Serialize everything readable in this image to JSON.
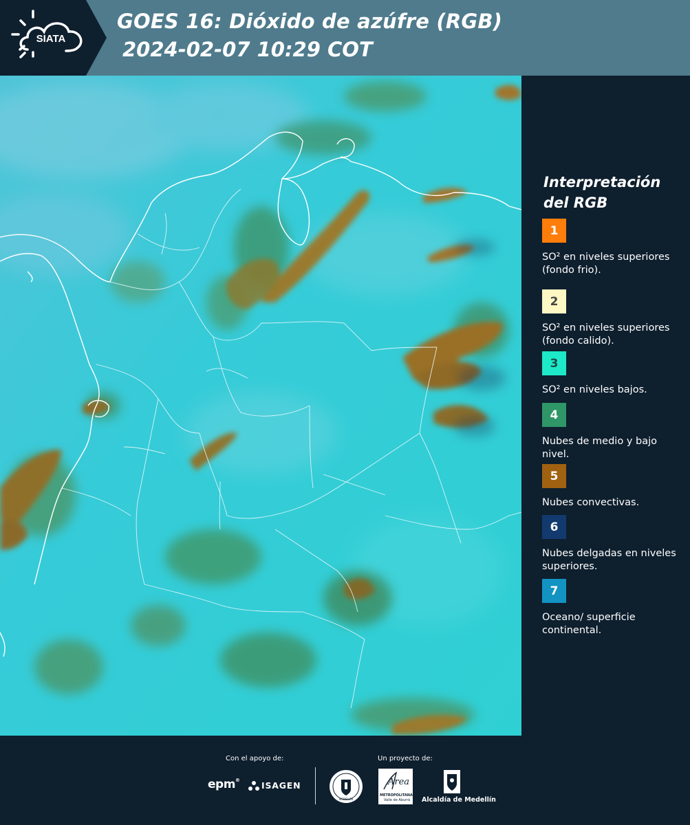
{
  "header": {
    "logo_text": "SIATA",
    "title_line1": "GOES 16: Dióxido de azúfre (RGB)",
    "title_line2": "2024-02-07 10:29 COT"
  },
  "legend": {
    "title_line1": "Interpretación",
    "title_line2": "del RGB",
    "items": [
      {
        "number": "1",
        "label": "SO² en niveles superiores (fondo frio).",
        "color": "#ff7d0a",
        "text_color": "#ffffff"
      },
      {
        "number": "2",
        "label": "SO² en niveles superiores (fondo calido).",
        "color": "#fff7c4",
        "text_color": "#444444"
      },
      {
        "number": "3",
        "label": "SO² en niveles bajos.",
        "color": "#1de8c8",
        "text_color": "#1c4a44"
      },
      {
        "number": "4",
        "label": "Nubes de medio y bajo nivel.",
        "color": "#2f9668",
        "text_color": "#ffffff"
      },
      {
        "number": "5",
        "label": "Nubes convectivas.",
        "color": "#a06210",
        "text_color": "#ffffff"
      },
      {
        "number": "6",
        "label": "Nubes delgadas en niveles superiores.",
        "color": "#123a6e",
        "text_color": "#ffffff"
      },
      {
        "number": "7",
        "label": "Oceano/ superficie continental.",
        "color": "#1293c2",
        "text_color": "#ffffff"
      }
    ]
  },
  "footer": {
    "support_label": "Con el apoyo de:",
    "project_label": "Un proyecto de:",
    "logo_epm": "epm",
    "logo_isagen": "ISAGEN",
    "logo_area_line1": "METROPOLITANA",
    "logo_area_line2": "Valle de Aburrá",
    "logo_area_script": "Área",
    "logo_alcaldia": "Alcaldía de Medellín",
    "logo_seal": "MEDELLÍN"
  },
  "colors": {
    "header_bg": "#4f7b8c",
    "dark_bg": "#0e1f2e",
    "map_base": "#32c6d6"
  }
}
